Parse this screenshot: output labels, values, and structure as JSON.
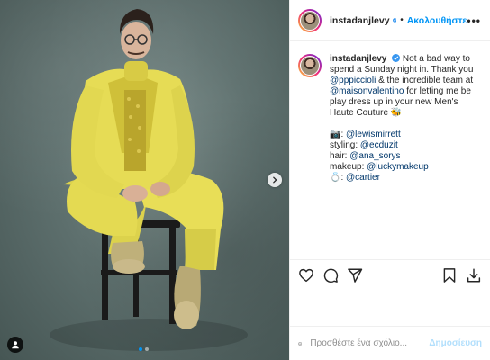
{
  "post": {
    "username": "instadanjlevy",
    "follow_label": "Ακολουθήστε",
    "separator": "•",
    "more_label": "•••",
    "caption": {
      "username": "instadanjlevy",
      "line1": "Not a bad way to",
      "line2": "spend a Sunday night in. Thank you",
      "mention1": "@pppiccioli",
      "line3_tail": " & the incredible team at",
      "mention2": "@maisonvalentino",
      "line4_tail": " for letting me be",
      "line5": "play dress up in your new Men's",
      "line6": "Haute Couture 🐝",
      "credit_photo_label": ": ",
      "credit_photo_mention": "@lewismirrett",
      "credit_styling_label": "styling: ",
      "credit_styling_mention": "@ecduzit",
      "credit_hair_label": "hair: ",
      "credit_hair_mention": "@ana_sorys",
      "credit_makeup_label": "makeup: ",
      "credit_makeup_mention": "@luckymakeup",
      "credit_jewel_label": ": ",
      "credit_jewel_mention": "@cartier"
    },
    "comment_placeholder": "Προσθέστε ένα σχόλιο...",
    "post_label": "Δημοσίευση",
    "carousel": {
      "total": 2,
      "active_index": 0
    }
  },
  "icons": {
    "verified": "verified-badge-icon",
    "like": "heart-icon",
    "comment": "comment-icon",
    "share": "paper-plane-icon",
    "save": "bookmark-icon",
    "download": "download-icon",
    "emoji": "emoji-icon",
    "next": "chevron-right-icon",
    "user_tag": "user-tag-icon",
    "camera": "camera-emoji",
    "ring": "ring-emoji"
  },
  "colors": {
    "link_blue": "#0095f6",
    "mention_blue": "#00376b",
    "post_disabled": "#b2dffc",
    "suit_yellow": "#e8de57"
  }
}
